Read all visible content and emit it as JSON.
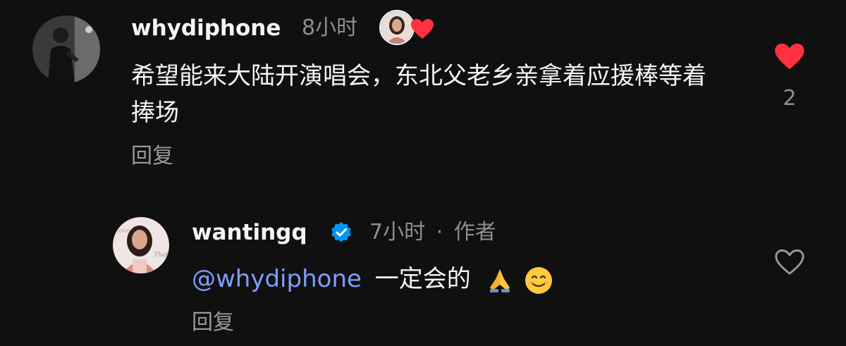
{
  "comment": {
    "username": "whydiphone",
    "time": "8小时",
    "text": "希望能来大陆开演唱会，东北父老乡亲拿着应援棒等着捧场",
    "reply_label": "回复",
    "like_count": "2",
    "liked": true,
    "liked_by_author_icon": "avatar-heart-icon"
  },
  "reply": {
    "username": "wantingq",
    "verified": true,
    "time": "7小时",
    "separator": "·",
    "author_badge": "作者",
    "mention": "@whydiphone",
    "text": "一定会的",
    "emojis": [
      "folded-hands-icon",
      "smiling-face-icon"
    ],
    "reply_label": "回复",
    "liked": false
  },
  "colors": {
    "background": "#101010",
    "heart_red": "#ff3040",
    "verified_blue": "#0095f6",
    "mention_blue": "#7f9dff"
  }
}
